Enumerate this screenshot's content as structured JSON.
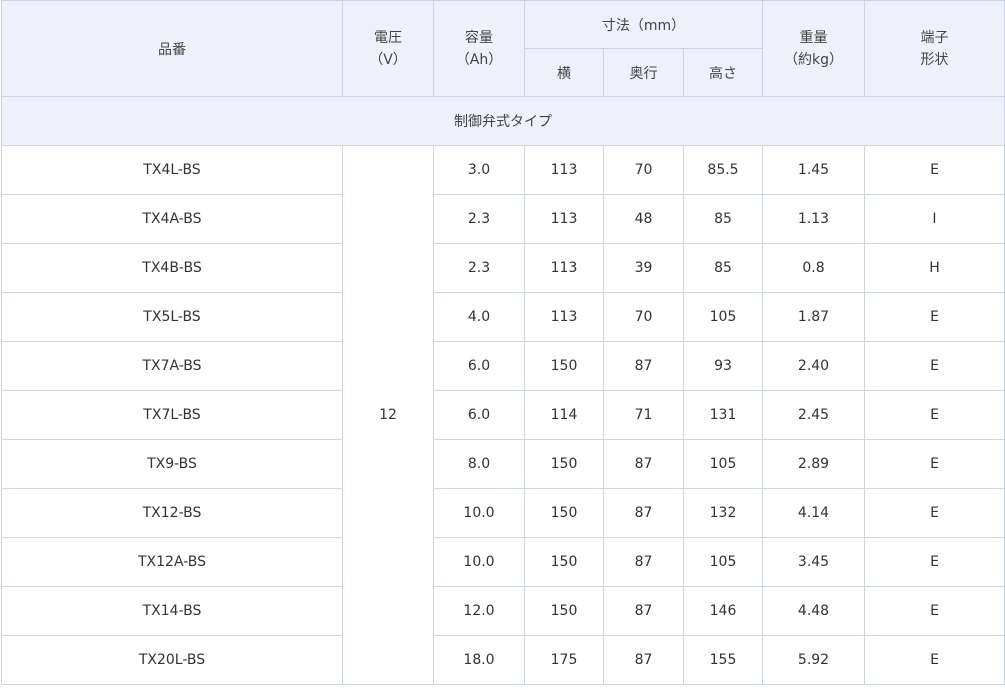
{
  "table": {
    "headers": {
      "part_number": "品番",
      "voltage": {
        "line1": "電圧",
        "line2": "（V）"
      },
      "capacity": {
        "line1": "容量",
        "line2": "（Ah）"
      },
      "dimensions": "寸法（mm）",
      "width": "横",
      "depth": "奥行",
      "height": "高さ",
      "weight": {
        "line1": "重量",
        "line2": "（約kg）"
      },
      "terminal": {
        "line1": "端子",
        "line2": "形状"
      }
    },
    "section_label": "制御弁式タイプ",
    "voltage_value": "12",
    "rows": [
      {
        "part": "TX4L-BS",
        "capacity": "3.0",
        "width": "113",
        "depth": "70",
        "height": "85.5",
        "weight": "1.45",
        "terminal": "E"
      },
      {
        "part": "TX4A-BS",
        "capacity": "2.3",
        "width": "113",
        "depth": "48",
        "height": "85",
        "weight": "1.13",
        "terminal": "I"
      },
      {
        "part": "TX4B-BS",
        "capacity": "2.3",
        "width": "113",
        "depth": "39",
        "height": "85",
        "weight": "0.8",
        "terminal": "H"
      },
      {
        "part": "TX5L-BS",
        "capacity": "4.0",
        "width": "113",
        "depth": "70",
        "height": "105",
        "weight": "1.87",
        "terminal": "E"
      },
      {
        "part": "TX7A-BS",
        "capacity": "6.0",
        "width": "150",
        "depth": "87",
        "height": "93",
        "weight": "2.40",
        "terminal": "E"
      },
      {
        "part": "TX7L-BS",
        "capacity": "6.0",
        "width": "114",
        "depth": "71",
        "height": "131",
        "weight": "2.45",
        "terminal": "E"
      },
      {
        "part": "TX9-BS",
        "capacity": "8.0",
        "width": "150",
        "depth": "87",
        "height": "105",
        "weight": "2.89",
        "terminal": "E"
      },
      {
        "part": "TX12-BS",
        "capacity": "10.0",
        "width": "150",
        "depth": "87",
        "height": "132",
        "weight": "4.14",
        "terminal": "E"
      },
      {
        "part": "TX12A-BS",
        "capacity": "10.0",
        "width": "150",
        "depth": "87",
        "height": "105",
        "weight": "3.45",
        "terminal": "E"
      },
      {
        "part": "TX14-BS",
        "capacity": "12.0",
        "width": "150",
        "depth": "87",
        "height": "146",
        "weight": "4.48",
        "terminal": "E"
      },
      {
        "part": "TX20L-BS",
        "capacity": "18.0",
        "width": "175",
        "depth": "87",
        "height": "155",
        "weight": "5.92",
        "terminal": "E"
      }
    ]
  }
}
